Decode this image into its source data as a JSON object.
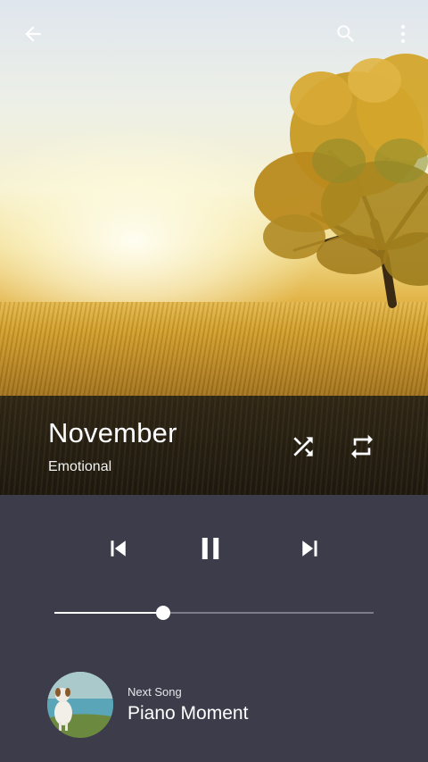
{
  "now_playing": {
    "title": "November",
    "artist": "Emotional"
  },
  "playback": {
    "progress_fraction": 0.34,
    "state": "playing"
  },
  "next_up": {
    "label": "Next Song",
    "title": "Piano Moment"
  },
  "icons": {
    "back": "arrow-left-icon",
    "search": "search-icon",
    "menu": "more-vertical-icon",
    "shuffle": "shuffle-icon",
    "repeat": "repeat-icon",
    "previous": "skip-previous-icon",
    "pause": "pause-icon",
    "next": "skip-next-icon"
  },
  "colors": {
    "controls_background": "#3d3c4a",
    "track_inactive": "#7d7c88",
    "accent": "#ffffff"
  }
}
